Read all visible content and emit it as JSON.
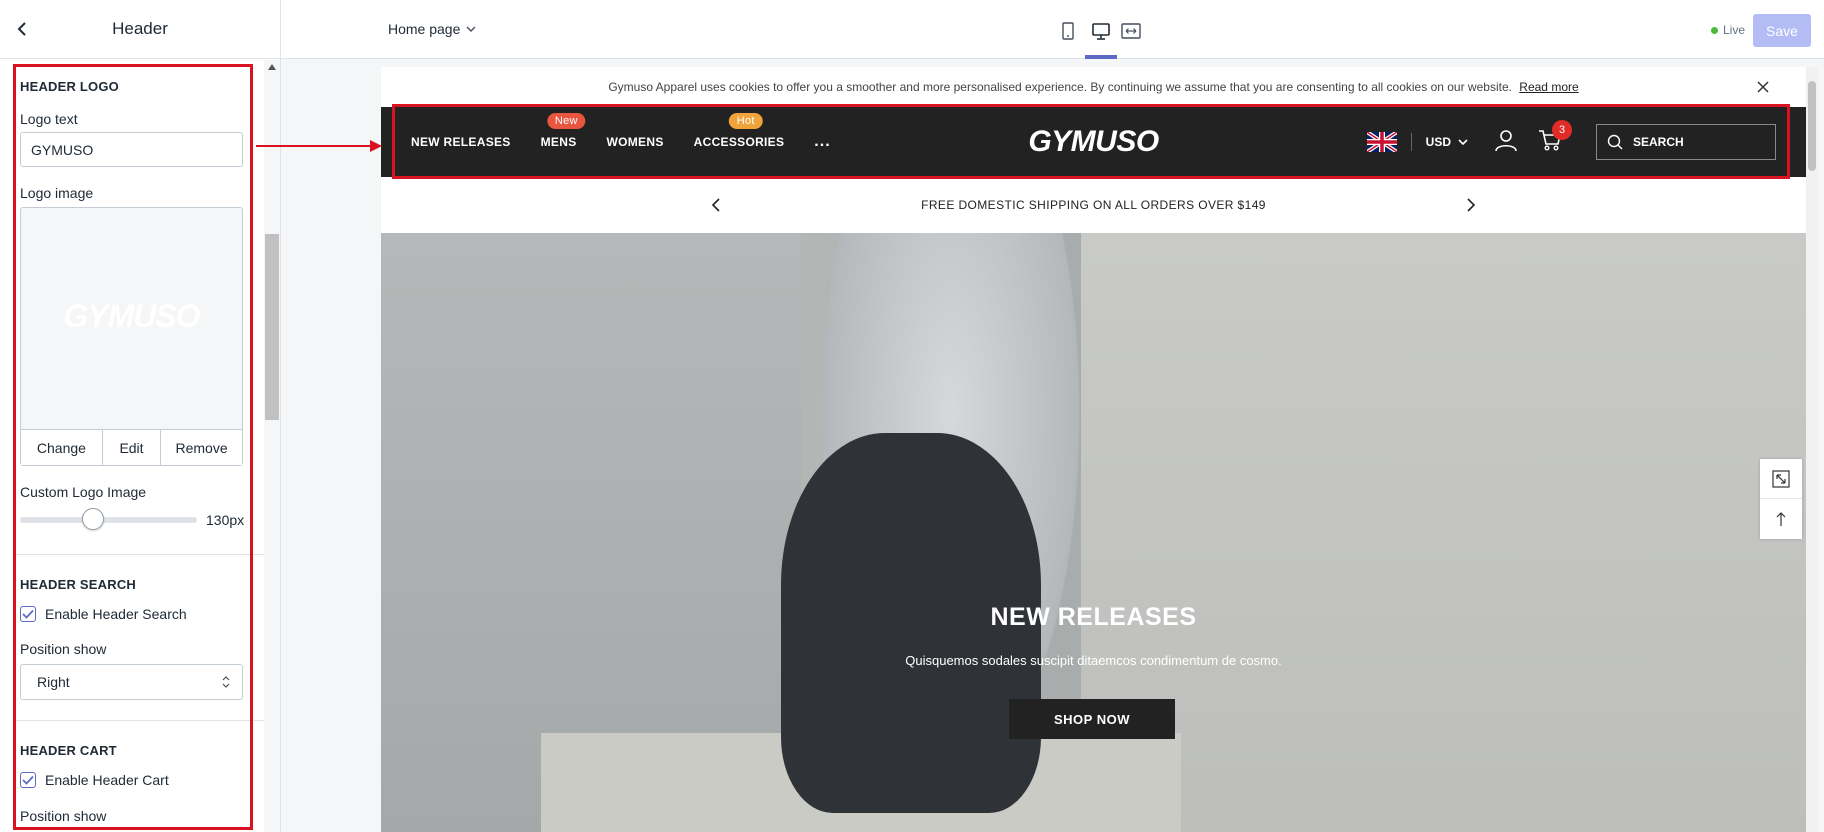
{
  "panel": {
    "title": "Header",
    "logo_section": {
      "title": "HEADER LOGO",
      "logo_text_label": "Logo text",
      "logo_text_value": "GYMUSO",
      "logo_image_label": "Logo image",
      "logo_image_preview": "GYMUSO",
      "change_label": "Change",
      "edit_label": "Edit",
      "remove_label": "Remove",
      "custom_logo_label": "Custom Logo Image",
      "custom_logo_value": "130px",
      "custom_logo_slider_fraction": 0.36
    },
    "search_section": {
      "title": "HEADER SEARCH",
      "enable_label": "Enable Header Search",
      "enable_checked": true,
      "position_label": "Position show",
      "position_value": "Right"
    },
    "cart_section": {
      "title": "HEADER CART",
      "enable_label": "Enable Header Cart",
      "enable_checked": true,
      "position_label": "Position show"
    }
  },
  "topbar": {
    "page_select": "Home page",
    "devices": [
      "mobile-icon",
      "desktop-icon",
      "fullwidth-icon"
    ],
    "active_device": "desktop-icon",
    "live_label": "Live",
    "save_label": "Save"
  },
  "preview": {
    "cookie_text": "Gymuso Apparel uses cookies to offer you a smoother and more personalised experience. By continuing we assume that you are consenting to all cookies on our website.",
    "cookie_link": "Read more",
    "nav": [
      {
        "label": "NEW RELEASES",
        "badge": ""
      },
      {
        "label": "MENS",
        "badge": "New",
        "badge_color": "#e8563f"
      },
      {
        "label": "WOMENS",
        "badge": ""
      },
      {
        "label": "ACCESSORIES",
        "badge": "Hot",
        "badge_color": "#f0a33a"
      }
    ],
    "nav_more": "...",
    "brand": "GYMUSO",
    "currency": "USD",
    "cart_count": "3",
    "search_placeholder": "SEARCH",
    "shipping_text": "FREE DOMESTIC SHIPPING ON ALL ORDERS OVER $149",
    "hero_title": "NEW RELEASES",
    "hero_subtitle": "Quisquemos sodales suscipit ditaemcos condimentum de cosmo.",
    "hero_button": "SHOP NOW"
  },
  "colors": {
    "accent": "#5c6ac4",
    "highlight": "#d8121e",
    "header_bg": "#222222"
  }
}
